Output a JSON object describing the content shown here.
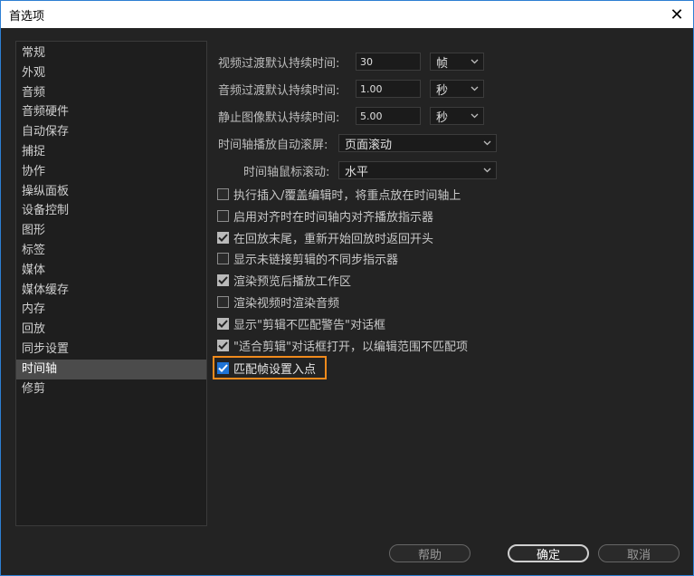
{
  "window": {
    "title": "首选项",
    "close_glyph": "✕"
  },
  "sidebar": {
    "items": [
      {
        "label": "常规"
      },
      {
        "label": "外观"
      },
      {
        "label": "音频"
      },
      {
        "label": "音频硬件"
      },
      {
        "label": "自动保存"
      },
      {
        "label": "捕捉"
      },
      {
        "label": "协作"
      },
      {
        "label": "操纵面板"
      },
      {
        "label": "设备控制"
      },
      {
        "label": "图形"
      },
      {
        "label": "标签"
      },
      {
        "label": "媒体"
      },
      {
        "label": "媒体缓存"
      },
      {
        "label": "内存"
      },
      {
        "label": "回放"
      },
      {
        "label": "同步设置"
      },
      {
        "label": "时间轴"
      },
      {
        "label": "修剪"
      }
    ],
    "selected_index": 16
  },
  "settings": {
    "video_transition": {
      "label": "视频过渡默认持续时间:",
      "value": "30",
      "unit": "帧"
    },
    "audio_transition": {
      "label": "音频过渡默认持续时间:",
      "value": "1.00",
      "unit": "秒"
    },
    "still_image": {
      "label": "静止图像默认持续时间:",
      "value": "5.00",
      "unit": "秒"
    },
    "playback_autoscroll": {
      "label": "时间轴播放自动滚屏:",
      "value": "页面滚动"
    },
    "mouse_scroll": {
      "label": "时间轴鼠标滚动:",
      "value": "水平"
    }
  },
  "checkboxes": [
    {
      "label": "执行插入/覆盖编辑时，将重点放在时间轴上",
      "checked": false
    },
    {
      "label": "启用对齐时在时间轴内对齐播放指示器",
      "checked": false
    },
    {
      "label": "在回放末尾，重新开始回放时返回开头",
      "checked": true
    },
    {
      "label": "显示未链接剪辑的不同步指示器",
      "checked": false
    },
    {
      "label": "渲染预览后播放工作区",
      "checked": true
    },
    {
      "label": "渲染视频时渲染音频",
      "checked": false
    },
    {
      "label": "显示\"剪辑不匹配警告\"对话框",
      "checked": true
    },
    {
      "label": "\"适合剪辑\"对话框打开，以编辑范围不匹配项",
      "checked": true
    },
    {
      "label": "匹配帧设置入点",
      "checked": true
    }
  ],
  "buttons": {
    "help": "帮助",
    "ok": "确定",
    "cancel": "取消"
  },
  "colors": {
    "accent": "#1f74d6",
    "highlight": "#f08a1c",
    "background": "#232323"
  }
}
